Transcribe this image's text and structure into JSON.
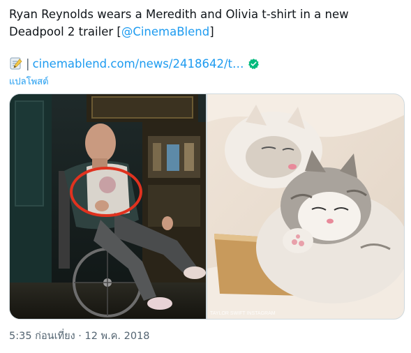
{
  "tweet": {
    "text": "Ryan Reynolds wears a Meredith and Olivia t-shirt in a new Deadpool 2 trailer [",
    "mention": "@CinemaBlend",
    "text_end": "]",
    "link_separator": "|",
    "link_url": "cinemablend.com/news/2418642/t…",
    "translate_label": "แปลโพสต์",
    "timestamp": "5:35 ก่อนเที่ยง · 12 พ.ค. 2018",
    "watermark": "TAYLOR SWIFT INSTAGRAM"
  },
  "icons": {
    "memo": "memo-icon",
    "verified": "verified-badge-icon"
  },
  "colors": {
    "text": "#0f1419",
    "link": "#1d9bf0",
    "secondary": "#536471",
    "border": "#cfd9de",
    "circle_annotation": "#e0321f"
  }
}
